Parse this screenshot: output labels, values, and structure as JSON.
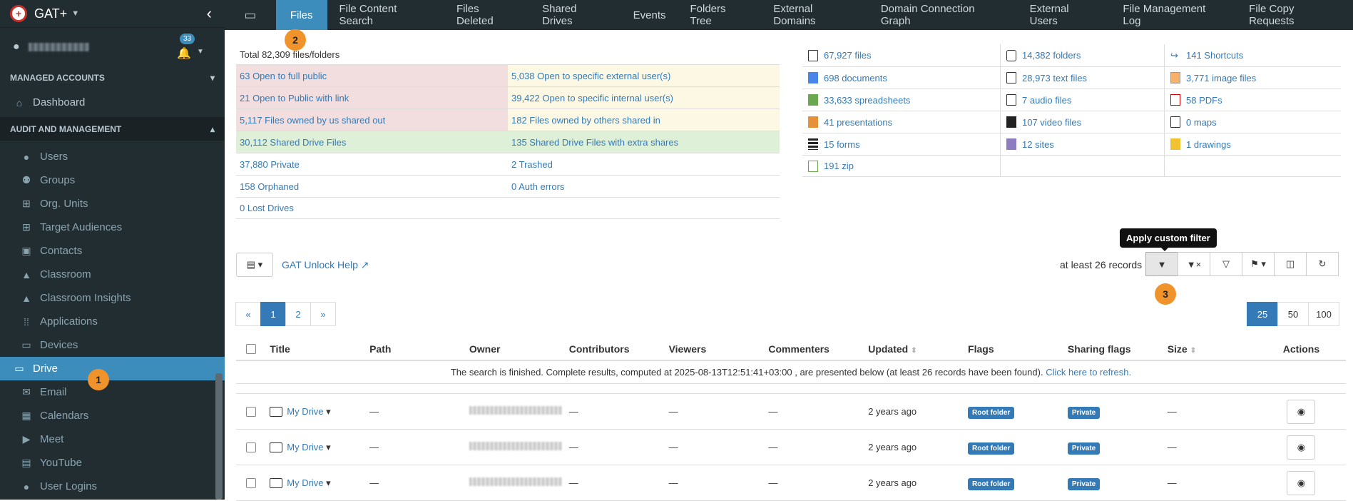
{
  "app": {
    "title": "GAT+",
    "notif_count": "33"
  },
  "sidebar": {
    "section_managed": "MANAGED ACCOUNTS",
    "dashboard": "Dashboard",
    "section_audit": "AUDIT AND MANAGEMENT",
    "items": [
      {
        "label": "Users",
        "icon": "user-icon"
      },
      {
        "label": "Groups",
        "icon": "users-icon"
      },
      {
        "label": "Org. Units",
        "icon": "sitemap-icon"
      },
      {
        "label": "Target Audiences",
        "icon": "sitemap-icon"
      },
      {
        "label": "Contacts",
        "icon": "contact-icon"
      },
      {
        "label": "Classroom",
        "icon": "graduation-cap-icon"
      },
      {
        "label": "Classroom Insights",
        "icon": "graduation-search-icon"
      },
      {
        "label": "Applications",
        "icon": "grid-icon"
      },
      {
        "label": "Devices",
        "icon": "devices-icon"
      },
      {
        "label": "Drive",
        "icon": "hdd-icon"
      },
      {
        "label": "Email",
        "icon": "envelope-icon"
      },
      {
        "label": "Calendars",
        "icon": "calendar-icon"
      },
      {
        "label": "Meet",
        "icon": "video-icon"
      },
      {
        "label": "YouTube",
        "icon": "film-icon"
      },
      {
        "label": "User Logins",
        "icon": "login-icon"
      }
    ]
  },
  "markers": {
    "m1": "1",
    "m2": "2",
    "m3": "3"
  },
  "tabs": [
    "Files",
    "File Content Search",
    "Files Deleted",
    "Shared Drives",
    "Events",
    "Folders Tree",
    "External Domains",
    "Domain Connection Graph",
    "External Users",
    "File Management Log",
    "File Copy Requests"
  ],
  "stats": {
    "total": "Total 82,309 files/folders",
    "rows": [
      [
        "63 Open to full public",
        "5,038 Open to specific external user(s)"
      ],
      [
        "21 Open to Public with link",
        "39,422 Open to specific internal user(s)"
      ],
      [
        "5,117 Files owned by us shared out",
        "182 Files owned by others shared in"
      ],
      [
        "30,112 Shared Drive Files",
        "135 Shared Drive Files with extra shares"
      ],
      [
        "37,880 Private",
        "2 Trashed"
      ],
      [
        "158 Orphaned",
        "0 Auth errors"
      ],
      [
        "0 Lost Drives",
        ""
      ]
    ]
  },
  "types": [
    [
      "67,927 files",
      "14,382 folders",
      "141 Shortcuts"
    ],
    [
      "698 documents",
      "28,973 text files",
      "3,771 image files"
    ],
    [
      "33,633 spreadsheets",
      "7 audio files",
      "58 PDFs"
    ],
    [
      "41 presentations",
      "107 video files",
      "0 maps"
    ],
    [
      "15 forms",
      "12 sites",
      "1 drawings"
    ],
    [
      "191 zip",
      "",
      ""
    ]
  ],
  "toolbar": {
    "help": "GAT Unlock Help",
    "records": "at least 26 records",
    "tooltip": "Apply custom filter"
  },
  "pager": [
    "«",
    "1",
    "2",
    "»"
  ],
  "page_sizes": [
    "25",
    "50",
    "100"
  ],
  "grid": {
    "headers": [
      "Title",
      "Path",
      "Owner",
      "Contributors",
      "Viewers",
      "Commenters",
      "Updated",
      "Flags",
      "Sharing flags",
      "Size",
      "Actions"
    ],
    "notice": "The search is finished. Complete results, computed at 2025-08-13T12:51:41+03:00 , are presented below (at least 26 records have been found).",
    "refresh": "Click here to refresh.",
    "rows": [
      {
        "title": "My Drive",
        "path": "—",
        "contrib": "—",
        "viewers": "—",
        "comm": "—",
        "updated": "2 years ago",
        "flag": "Root folder",
        "sharing": "Private",
        "size": "—"
      },
      {
        "title": "My Drive",
        "path": "—",
        "contrib": "—",
        "viewers": "—",
        "comm": "—",
        "updated": "2 years ago",
        "flag": "Root folder",
        "sharing": "Private",
        "size": "—"
      },
      {
        "title": "My Drive",
        "path": "—",
        "contrib": "—",
        "viewers": "—",
        "comm": "—",
        "updated": "2 years ago",
        "flag": "Root folder",
        "sharing": "Private",
        "size": "—"
      }
    ]
  }
}
